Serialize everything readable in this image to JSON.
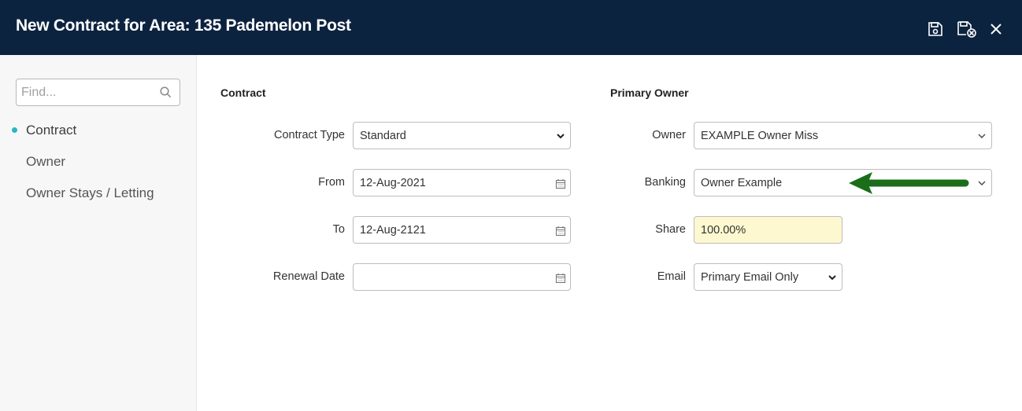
{
  "window": {
    "title": "New Contract for Area: 135 Pademelon Post",
    "actions": {
      "save_icon": "save-icon",
      "save_close_icon": "save-close-icon",
      "close_icon": "close-icon"
    }
  },
  "sidebar": {
    "search": {
      "placeholder": "Find...",
      "value": ""
    },
    "items": [
      {
        "label": "Contract",
        "active": true
      },
      {
        "label": "Owner",
        "active": false
      },
      {
        "label": "Owner Stays / Letting",
        "active": false
      }
    ]
  },
  "contract": {
    "section_title": "Contract",
    "contract_type": {
      "label": "Contract Type",
      "value": "Standard"
    },
    "from": {
      "label": "From",
      "value": "12-Aug-2021"
    },
    "to": {
      "label": "To",
      "value": "12-Aug-2121"
    },
    "renewal_date": {
      "label": "Renewal Date",
      "value": ""
    }
  },
  "primary_owner": {
    "section_title": "Primary Owner",
    "owner": {
      "label": "Owner",
      "value": "EXAMPLE Owner Miss"
    },
    "banking": {
      "label": "Banking",
      "value": "Owner Example"
    },
    "share": {
      "label": "Share",
      "value": "100.00%"
    },
    "email": {
      "label": "Email",
      "value": "Primary Email Only"
    }
  },
  "colors": {
    "header_bg": "#0c2340",
    "accent_dot": "#29b6c4",
    "share_bg": "#fdf8cf",
    "annotation_arrow": "#1a6e1a"
  }
}
